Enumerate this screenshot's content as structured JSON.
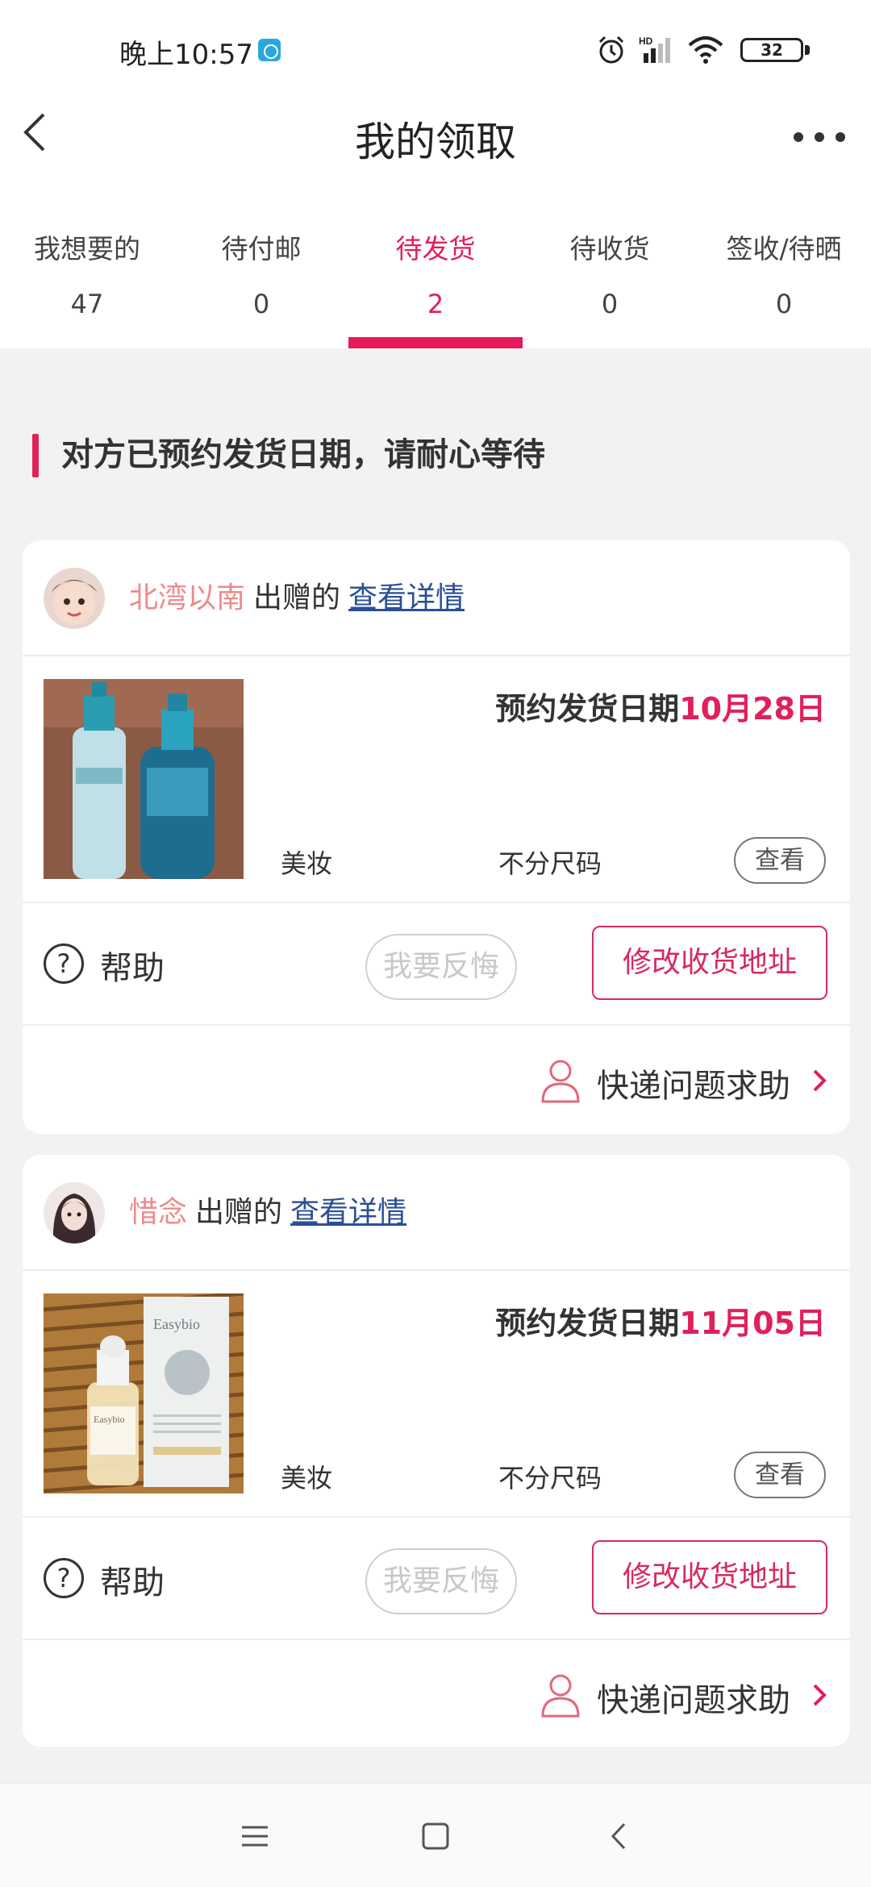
{
  "status_bar": {
    "time": "晚上10:57",
    "battery": "32"
  },
  "header": {
    "title": "我的领取"
  },
  "tabs": [
    {
      "label": "我想要的",
      "count": "47"
    },
    {
      "label": "待付邮",
      "count": "0"
    },
    {
      "label": "待发货",
      "count": "2"
    },
    {
      "label": "待收货",
      "count": "0"
    },
    {
      "label": "签收/待晒",
      "count": "0"
    }
  ],
  "active_tab": 2,
  "section": {
    "heading": "对方已预约发货日期，请耐心等待"
  },
  "orders": [
    {
      "giver_name": "北湾以南",
      "giver_verb": "出赠的",
      "detail_link": "查看详情",
      "ship_label": "预约发货日期",
      "ship_date": "10月28日",
      "category": "美妆",
      "size": "不分尺码",
      "view_label": "查看",
      "help_label": "帮助",
      "regret_label": "我要反悔",
      "address_label": "修改收货地址",
      "courier_label": "快递问题求助",
      "product_image": "two-blue-serum-bottles"
    },
    {
      "giver_name": "惜念",
      "giver_verb": "出赠的",
      "detail_link": "查看详情",
      "ship_label": "预约发货日期",
      "ship_date": "11月05日",
      "category": "美妆",
      "size": "不分尺码",
      "view_label": "查看",
      "help_label": "帮助",
      "regret_label": "我要反悔",
      "address_label": "修改收货地址",
      "courier_label": "快递问题求助",
      "product_image": "easybio-serum-bottle-and-box"
    }
  ],
  "colors": {
    "accent": "#e0205a",
    "giver_name": "#ef8a8a",
    "link": "#2a4f94"
  }
}
